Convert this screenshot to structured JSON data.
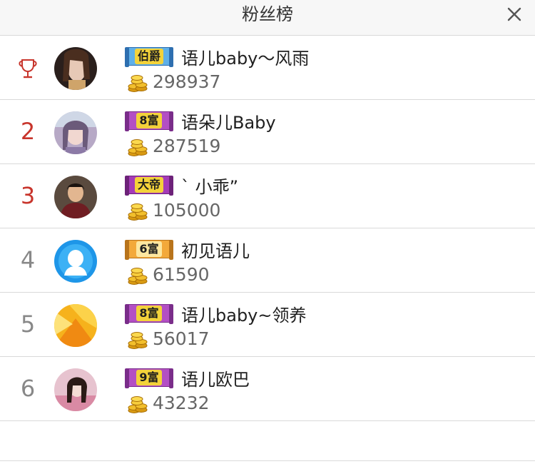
{
  "header": {
    "title": "粉丝榜"
  },
  "colors": {
    "rank_top": "#c8352c",
    "rank_normal": "#888888"
  },
  "fans": [
    {
      "rank": "",
      "rank_icon": "trophy-icon",
      "badge": "伯爵",
      "name": "语儿baby～风雨",
      "coins": "298937"
    },
    {
      "rank": "2",
      "badge": "8富",
      "name": "语朵儿Baby",
      "coins": "287519"
    },
    {
      "rank": "3",
      "badge": "大帝",
      "name": "ˋ 小乖”",
      "coins": "105000"
    },
    {
      "rank": "4",
      "badge": "6富",
      "name": "初见语儿",
      "coins": "61590"
    },
    {
      "rank": "5",
      "badge": "8富",
      "name": "语儿baby~领养",
      "coins": "56017"
    },
    {
      "rank": "6",
      "badge": "9富",
      "name": "语儿欧巴",
      "coins": "43232"
    }
  ]
}
